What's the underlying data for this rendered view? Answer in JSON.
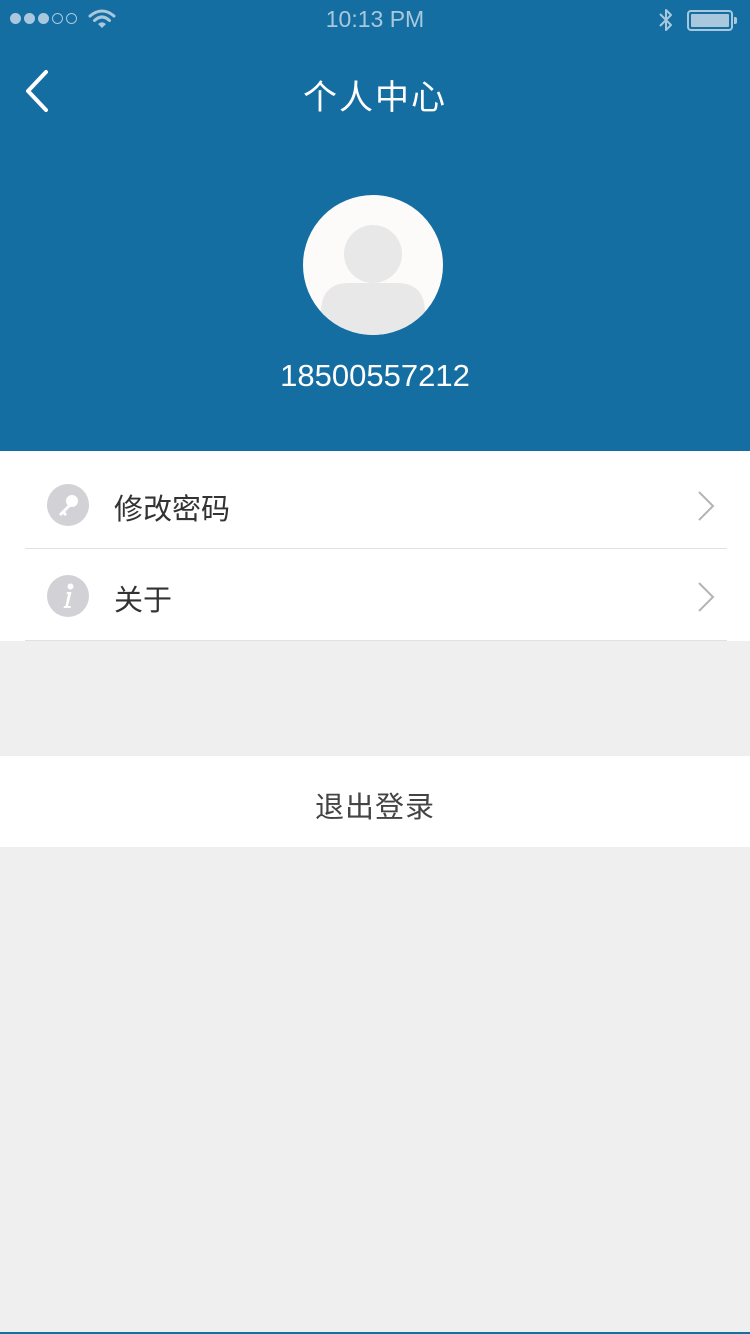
{
  "status_bar": {
    "time": "10:13 PM",
    "signal_filled": 3,
    "signal_total": 5
  },
  "header": {
    "title": "个人中心",
    "phone": "18500557212"
  },
  "menu": {
    "items": [
      {
        "label": "修改密码",
        "icon": "key-icon"
      },
      {
        "label": "关于",
        "icon": "info-icon"
      }
    ]
  },
  "logout": {
    "label": "退出登录"
  },
  "colors": {
    "brand": "#146ea2",
    "background": "#efefef",
    "icon_gray": "#d2d2d6"
  }
}
